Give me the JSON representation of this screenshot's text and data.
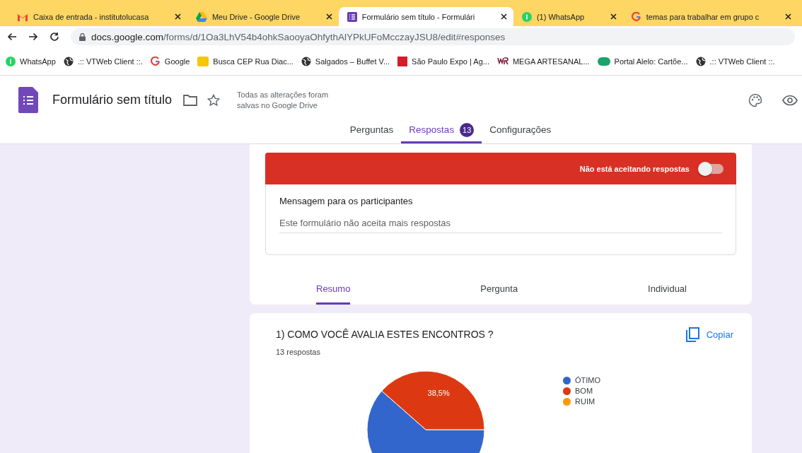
{
  "browser": {
    "tabs": [
      {
        "title": "Caixa de entrada - institutolucasa",
        "selected": false
      },
      {
        "title": "Meu Drive - Google Drive",
        "selected": false
      },
      {
        "title": "Formulário sem título - Formulári",
        "selected": true
      },
      {
        "title": "(1) WhatsApp",
        "selected": false
      },
      {
        "title": "temas para trabalhar em grupo c",
        "selected": false
      }
    ],
    "url_host": "docs.google.com",
    "url_path": "/forms/d/1Oa3LhV54b4ohkSaooyaOhfythAlYPkUFoMcczayJSU8/edit#responses",
    "bookmarks": [
      {
        "label": "WhatsApp"
      },
      {
        "label": ".:: VTWeb Client ::."
      },
      {
        "label": "Google"
      },
      {
        "label": "Busca CEP Rua Diac..."
      },
      {
        "label": "Salgados – Buffet V..."
      },
      {
        "label": "São Paulo Expo | Ag..."
      },
      {
        "label": "MEGA ARTESANAL..."
      },
      {
        "label": "Portal Alelo: Cartõe..."
      },
      {
        "label": ".:: VTWeb Client ::."
      }
    ]
  },
  "header": {
    "title": "Formulário sem título",
    "save_status": "Todas as alterações foram salvas no Google Drive",
    "tabs": [
      {
        "label": "Perguntas",
        "selected": false
      },
      {
        "label": "Respostas",
        "selected": true,
        "badge": "13"
      },
      {
        "label": "Configurações",
        "selected": false
      }
    ]
  },
  "responses": {
    "banner": "Não está aceitando respostas",
    "accepting": false,
    "message_label": "Mensagem para os participantes",
    "message_value": "Este formulário não aceita mais respostas",
    "views": [
      {
        "label": "Resumo",
        "selected": true
      },
      {
        "label": "Pergunta",
        "selected": false
      },
      {
        "label": "Individual",
        "selected": false
      }
    ]
  },
  "question": {
    "title": "1) COMO VOCÊ AVALIA ESTES ENCONTROS ?",
    "count": "13 respostas",
    "copy": "Copiar",
    "chart_data": {
      "type": "pie",
      "categories": [
        "ÓTIMO",
        "BOM",
        "RUIM"
      ],
      "values": [
        61.5,
        38.5,
        0
      ],
      "legend": "right",
      "value_labels": [
        null,
        "38,5%",
        null
      ]
    }
  }
}
